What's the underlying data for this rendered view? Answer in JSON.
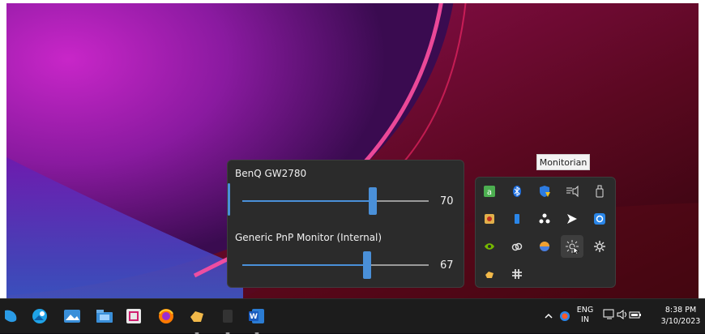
{
  "monitorian": {
    "monitors": [
      {
        "name": "BenQ GW2780",
        "brightness": 70
      },
      {
        "name": "Generic PnP Monitor (Internal)",
        "brightness": 67
      }
    ]
  },
  "tooltip": {
    "text": "Monitorian"
  },
  "tray_overflow": {
    "icons": [
      "greenshot-icon",
      "bluetooth-icon",
      "windows-security-icon",
      "sound-output-icon",
      "usb-safely-remove-icon",
      "app-orange-icon",
      "blue-bar-icon",
      "paw-icon",
      "arrow-right-icon",
      "screen-capture-icon",
      "nvidia-icon",
      "creative-cloud-icon",
      "color-circle-icon",
      "monitorian-brightness-icon",
      "settings-gear-icon",
      "hand-icon",
      "slack-icon"
    ]
  },
  "taskbar": {
    "apps": [
      "edge-icon",
      "photos-icon",
      "image-viewer-icon",
      "folder-icon",
      "snip-tool-icon",
      "firefox-icon",
      "hand-app-icon",
      "blank-app-icon",
      "word-icon"
    ],
    "language_line1": "ENG",
    "language_line2": "IN",
    "time": "8:38 PM",
    "date": "3/10/2023"
  },
  "colors": {
    "accent": "#4a90d9",
    "panel": "#2b2b2b",
    "taskbar": "#1c1c1c"
  }
}
